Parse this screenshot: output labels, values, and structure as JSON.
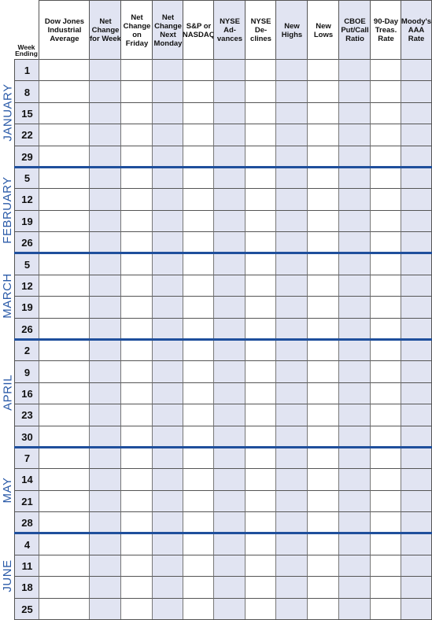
{
  "week_ending_label": "Week Ending",
  "columns": [
    {
      "label": "Dow Jones Industrial Average",
      "shaded": false
    },
    {
      "label": "Net Change for Week",
      "shaded": true
    },
    {
      "label": "Net Change on Friday",
      "shaded": false
    },
    {
      "label": "Net Change Next Monday",
      "shaded": true
    },
    {
      "label": "S&P or NASDAQ",
      "shaded": false
    },
    {
      "label": "NYSE Ad- vances",
      "shaded": true
    },
    {
      "label": "NYSE De- clines",
      "shaded": false
    },
    {
      "label": "New Highs",
      "shaded": true
    },
    {
      "label": "New Lows",
      "shaded": false
    },
    {
      "label": "CBOE Put/Call Ratio",
      "shaded": true
    },
    {
      "label": "90-Day Treas. Rate",
      "shaded": false
    },
    {
      "label": "Moody's AAA Rate",
      "shaded": true
    }
  ],
  "months": [
    {
      "name": "JANUARY",
      "weeks": [
        "1",
        "8",
        "15",
        "22",
        "29"
      ]
    },
    {
      "name": "FEBRUARY",
      "weeks": [
        "5",
        "12",
        "19",
        "26"
      ]
    },
    {
      "name": "MARCH",
      "weeks": [
        "5",
        "12",
        "19",
        "26"
      ]
    },
    {
      "name": "APRIL",
      "weeks": [
        "2",
        "9",
        "16",
        "23",
        "30"
      ]
    },
    {
      "name": "MAY",
      "weeks": [
        "7",
        "14",
        "21",
        "28"
      ]
    },
    {
      "name": "JUNE",
      "weeks": [
        "4",
        "11",
        "18",
        "25"
      ]
    }
  ],
  "colors": {
    "accent": "#1f4f9c",
    "shade": "#e1e4f2",
    "month_text": "#2a5aa8"
  }
}
